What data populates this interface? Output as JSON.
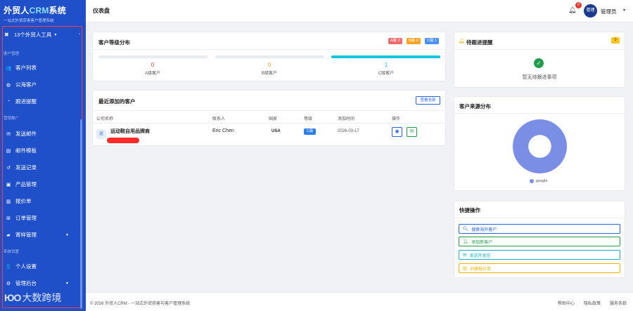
{
  "brand": {
    "title_prefix": "外贸人",
    "title_crm": "CRM",
    "title_suffix": "系统",
    "subtitle": "一站式外贸获客客户管理系统"
  },
  "sidebar": {
    "tools_label": "13个外贸人工具",
    "sections": {
      "customer": "客户管理",
      "marketing": "营销推广",
      "system": "系统设置"
    },
    "items": [
      {
        "label": "客户列表",
        "icon": "users-icon"
      },
      {
        "label": "公海客户",
        "icon": "globe-icon"
      },
      {
        "label": "跟进提醒",
        "icon": "clock-icon"
      },
      {
        "label": "发送邮件",
        "icon": "envelope-icon"
      },
      {
        "label": "邮件模板",
        "icon": "file-icon"
      },
      {
        "label": "发送记录",
        "icon": "history-icon"
      },
      {
        "label": "产品管理",
        "icon": "box-icon"
      },
      {
        "label": "报价单",
        "icon": "document-icon"
      },
      {
        "label": "订单管理",
        "icon": "cart-icon"
      },
      {
        "label": "寄样管理",
        "icon": "truck-icon"
      },
      {
        "label": "个人设置",
        "icon": "user-gear-icon"
      },
      {
        "label": "管理后台",
        "icon": "gears-icon"
      }
    ]
  },
  "watermark": {
    "logo": "ЮО",
    "text": "大数跨境"
  },
  "header": {
    "page_title": "仪表盘",
    "notification_count": "0",
    "avatar_text": "管理",
    "user_name": "管理员"
  },
  "level_card": {
    "title": "客户等级分布",
    "badges": [
      {
        "label": "A级 0",
        "color": "#f26b6b"
      },
      {
        "label": "B级 0",
        "color": "#f5a524"
      },
      {
        "label": "C级 1",
        "color": "#4a8ff0"
      }
    ],
    "levels": [
      {
        "count": "0",
        "label": "A级客户",
        "fraction": 0,
        "color": "#e53935"
      },
      {
        "count": "0",
        "label": "B级客户",
        "fraction": 0,
        "color": "#f0a500"
      },
      {
        "count": "1",
        "label": "C级客户",
        "fraction": 1,
        "color": "#17c4e0"
      }
    ]
  },
  "recent_card": {
    "title": "最近添加的客户",
    "view_all": "查看全部",
    "columns": [
      "公司名称",
      "联系人",
      "国家",
      "等级",
      "添加时间",
      "操作"
    ],
    "rows": [
      {
        "icon_text": "运",
        "company": "运动鞋自用品牌商",
        "contact": "Eric Chen",
        "country": "USA",
        "level": "C级",
        "date": "2026-03-17"
      }
    ]
  },
  "followup_card": {
    "title": "待跟进提醒",
    "count": "0",
    "empty_text": "暂无待跟进事项"
  },
  "source_card": {
    "title": "客户来源分布",
    "chart_data": {
      "type": "pie",
      "categories": [
        "google"
      ],
      "values": [
        1
      ]
    }
  },
  "quick_card": {
    "title": "快捷操作",
    "actions": [
      {
        "label": "搜索海外客户",
        "icon": "search-icon",
        "color": "#2563eb"
      },
      {
        "label": "添加新客户",
        "icon": "user-plus-icon",
        "color": "#1e9e4a"
      },
      {
        "label": "发送开发信",
        "icon": "envelope-icon",
        "color": "#17b3d6"
      },
      {
        "label": "创建报价单",
        "icon": "document-icon",
        "color": "#f0b400"
      }
    ]
  },
  "footer": {
    "copyright": "© 2026 外贸人CRM - 一站式外贸获客与客户管理系统",
    "links": [
      "帮助中心",
      "隐私政策",
      "服务条款"
    ]
  }
}
